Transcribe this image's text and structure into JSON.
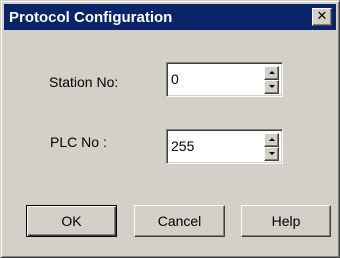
{
  "window": {
    "title": "Protocol Configuration",
    "close_glyph": "✕",
    "titlebar_color": "#0a246a",
    "face_color": "#d4d0c8"
  },
  "fields": {
    "station": {
      "label": "Station No:",
      "value": "0"
    },
    "plc": {
      "label": "PLC No :",
      "value": "255"
    }
  },
  "buttons": {
    "ok_label": "OK",
    "cancel_label": "Cancel",
    "help_label": "Help"
  },
  "icons": {
    "close": "close-icon",
    "spin_up": "spin-up-arrow-icon",
    "spin_down": "spin-down-arrow-icon"
  }
}
